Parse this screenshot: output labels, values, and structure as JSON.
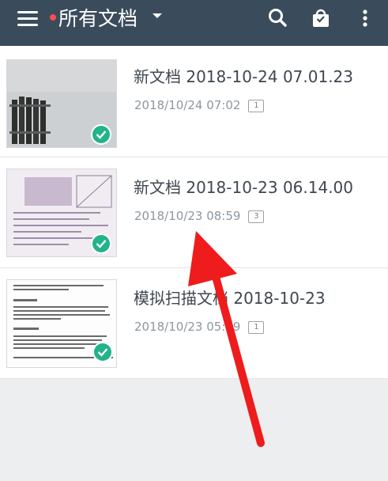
{
  "appbar": {
    "title": "所有文档",
    "icons": [
      "menu-icon",
      "search-icon",
      "shopping-bag-icon",
      "more-vert-icon"
    ],
    "background": "#3a4c5c"
  },
  "documents": [
    {
      "name": "新文档 2018-10-24 07.01.23",
      "datetime": "2018/10/24 07:02",
      "page_count": "1",
      "synced": true
    },
    {
      "name": "新文档 2018-10-23 06.14.00",
      "datetime": "2018/10/23 08:59",
      "page_count": "3",
      "synced": true
    },
    {
      "name": "模拟扫描文档 2018-10-23",
      "datetime": "2018/10/23 05:59",
      "page_count": "1",
      "synced": true
    }
  ],
  "colors": {
    "accent_check": "#22b38b",
    "annotation_arrow": "#ee1c1c"
  }
}
